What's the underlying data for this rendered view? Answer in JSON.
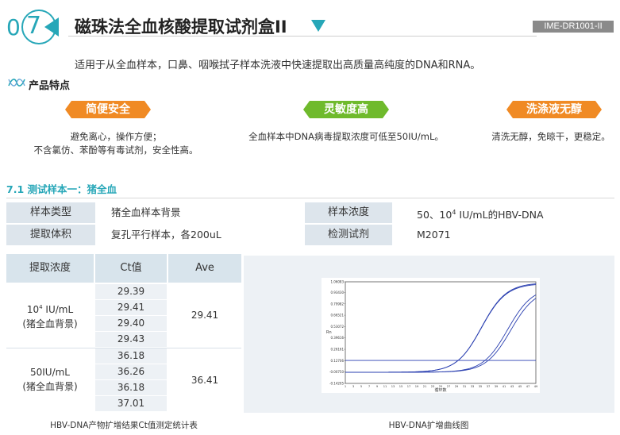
{
  "header": {
    "number_zero": "0",
    "number_seven": "7",
    "title": "磁珠法全血核酸提取试剂盒II",
    "code": "IME-DR1001-II",
    "subtitle": "适用于从全血样本，口鼻、咽喉拭子样本洗液中快速提取出高质量高纯度的DNA和RNA。"
  },
  "features": {
    "title": "产品特点",
    "items": [
      {
        "badge": "简便安全",
        "lines": [
          "避免离心，操作方便；",
          "不含氯仿、苯酚等有毒试剂，安全性高。"
        ]
      },
      {
        "badge": "灵敏度高",
        "lines": [
          "全血样本中DNA病毒提取浓度可低至50IU/mL。"
        ]
      },
      {
        "badge": "洗涤液无醇",
        "lines": [
          "清洗无醇，免晾干，更稳定。"
        ]
      }
    ]
  },
  "section": {
    "title": "7.1 测试样本一：猪全血"
  },
  "info_table": {
    "rows": [
      {
        "k1": "样本类型",
        "v1": "猪全血样本背景",
        "k2": "样本浓度",
        "v2_pre": "50、10",
        "v2_sup": "4",
        "v2_post": " IU/mL的HBV-DNA"
      },
      {
        "k1": "提取体积",
        "v1": "复孔平行样本，各200uL",
        "k2": "检测试剂",
        "v2": "M2071"
      }
    ]
  },
  "results_table": {
    "headers": [
      "提取浓度",
      "Ct值",
      "Ave"
    ],
    "groups": [
      {
        "label_pre": "10",
        "label_sup": "4",
        "label_post": " IU/mL",
        "label2": "(猪全血背景)",
        "ct": [
          "29.39",
          "29.41",
          "29.40",
          "29.43"
        ],
        "ave": "29.41"
      },
      {
        "label_pre": "50IU/mL",
        "label2": "(猪全血背景)",
        "ct": [
          "36.18",
          "36.26",
          "36.18",
          "37.01"
        ],
        "ave": "36.41"
      }
    ],
    "caption": "HBV-DNA产物扩增结果Ct值测定统计表"
  },
  "chart_data": {
    "type": "line",
    "title": "",
    "xlabel": "循环数",
    "ylabel": "Rn",
    "x_ticks": [
      "1",
      "3",
      "5",
      "7",
      "9",
      "11",
      "13",
      "15",
      "17",
      "19",
      "21",
      "23",
      "25",
      "27",
      "29",
      "31",
      "33",
      "35",
      "37",
      "39",
      "41",
      "43",
      "45",
      "47",
      "49"
    ],
    "y_ticks": [
      "1.06083",
      "0.93430",
      "0.79982",
      "0.66521",
      "0.53072",
      "0.39616",
      "0.26161",
      "0.12706",
      "-0.00750",
      "-0.14205"
    ],
    "ylim": [
      -0.14205,
      1.06083
    ],
    "xlim": [
      1,
      49
    ],
    "threshold": 0.13,
    "series": [
      {
        "ct": 29.4,
        "plateau": 1.05,
        "color": "#2a3fb0"
      },
      {
        "ct": 29.43,
        "plateau": 1.04,
        "color": "#2a3fb0"
      },
      {
        "ct": 36.18,
        "plateau": 1.0,
        "color": "#2a3fb0"
      },
      {
        "ct": 37.01,
        "plateau": 0.98,
        "color": "#2a3fb0"
      }
    ],
    "caption": "HBV-DNA扩增曲线图"
  },
  "colors": {
    "accent": "#27a7b8",
    "orange": "#f08a24",
    "green": "#6fba2c",
    "line": "#2a3fb0"
  }
}
